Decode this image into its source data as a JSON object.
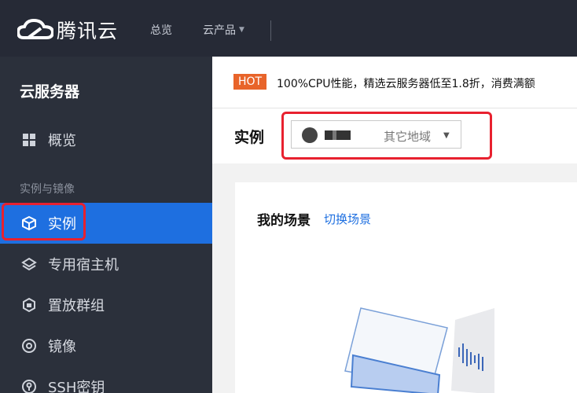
{
  "topbar": {
    "brand": "腾讯云",
    "nav_overview": "总览",
    "nav_products": "云产品"
  },
  "sidebar": {
    "title": "云服务器",
    "overview": "概览",
    "section": "实例与镜像",
    "items": [
      {
        "label": "实例",
        "icon": "cube-icon",
        "active": true
      },
      {
        "label": "专用宿主机",
        "icon": "layers-icon"
      },
      {
        "label": "置放群组",
        "icon": "shield-box-icon"
      },
      {
        "label": "镜像",
        "icon": "disc-icon"
      },
      {
        "label": "SSH密钥",
        "icon": "key-icon"
      }
    ]
  },
  "announcement": {
    "badge": "HOT",
    "text": "100%CPU性能，精选云服务器低至1.8折，消费满额"
  },
  "instances": {
    "title": "实例",
    "region_other": "其它地域"
  },
  "scene": {
    "title": "我的场景",
    "switch_link": "切换场景"
  },
  "colors": {
    "topbar_bg": "#262a36",
    "sidebar_bg": "#2b303b",
    "active_blue": "#1e6fe0",
    "highlight_red": "#e8212f",
    "hot_orange": "#e8642a"
  }
}
